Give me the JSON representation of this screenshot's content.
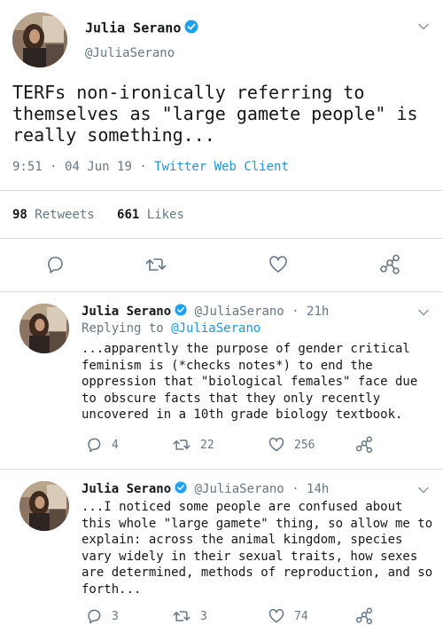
{
  "main_tweet": {
    "display_name": "Julia Serano",
    "handle": "@JuliaSerano",
    "text": "TERFs non-ironically referring to themselves as \"large gamete people\" is really something...",
    "time": "9:51",
    "date": "04 Jun 19",
    "client": "Twitter Web Client",
    "retweets_count": "98",
    "retweets_label": "Retweets",
    "likes_count": "661",
    "likes_label": "Likes"
  },
  "replies": [
    {
      "display_name": "Julia Serano",
      "handle": "@JuliaSerano",
      "age": "21h",
      "replying_label": "Replying to",
      "replying_handle": "@JuliaSerano",
      "text": "...apparently the purpose of gender critical feminism is (*checks notes*) to end the oppression that \"biological females\" face due to obscure facts that they only recently uncovered in a 10th grade biology textbook.",
      "reply_count": "4",
      "retweet_count": "22",
      "like_count": "256"
    },
    {
      "display_name": "Julia Serano",
      "handle": "@JuliaSerano",
      "age": "14h",
      "text": "...I noticed some people are confused about this whole \"large gamete\" thing, so allow me to explain: across the animal kingdom, species vary widely in their sexual traits, how sexes are determined, methods of reproduction, and so forth...",
      "reply_count": "3",
      "retweet_count": "3",
      "like_count": "74"
    }
  ],
  "colors": {
    "text": "#14171a",
    "muted": "#657786",
    "link": "#1b95e0",
    "verified": "#1da1f2",
    "divider": "#d8dde2"
  },
  "icons": [
    "verified-badge-icon",
    "chevron-down-icon",
    "reply-icon",
    "retweet-icon",
    "like-icon",
    "share-icon"
  ]
}
